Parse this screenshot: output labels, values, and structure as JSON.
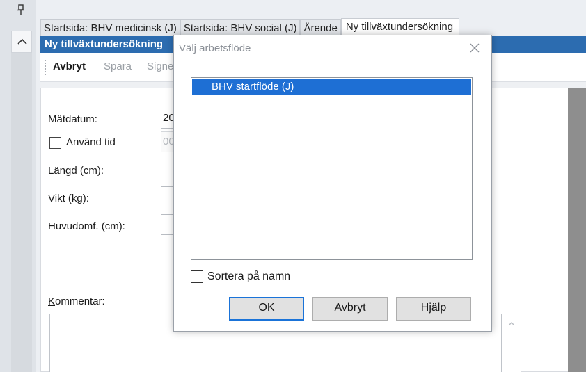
{
  "tabs": [
    {
      "label": "Startsida: BHV medicinsk (J)",
      "active": false
    },
    {
      "label": "Startsida: BHV social (J)",
      "active": false
    },
    {
      "label": "Ärende",
      "active": false
    },
    {
      "label": "Ny tillväxtundersökning",
      "active": true
    }
  ],
  "window": {
    "title": "Ny tillväxtundersökning"
  },
  "toolbar": {
    "cancel_label": "Avbryt",
    "save_label": "Spara",
    "sign_label": "Signera"
  },
  "form": {
    "measure_date_label": "Mätdatum:",
    "measure_date_value": "20",
    "use_time_label": "Använd tid",
    "use_time_checked": false,
    "time_value": "00",
    "length_label": "Längd (cm):",
    "length_value": "",
    "weight_label": "Vikt (kg):",
    "weight_value": "",
    "head_label": "Huvudomf. (cm):",
    "head_value": "",
    "comment_label_first": "K",
    "comment_label_rest": "ommentar:",
    "comment_value": ""
  },
  "dialog": {
    "title": "Välj arbetsflöde",
    "items": [
      {
        "label": "BHV startflöde (J)",
        "selected": true
      }
    ],
    "sort_label": "Sortera på namn",
    "sort_checked": false,
    "ok_label": "OK",
    "cancel_label": "Avbryt",
    "help_label": "Hjälp"
  },
  "colors": {
    "title_bar": "#2c6cb0",
    "selection": "#1e6fd4",
    "default_button_border": "#1a73d8"
  },
  "icons": {
    "pin": "pin-icon",
    "collapse": "chevron-up-icon",
    "close": "close-icon",
    "scroll_up": "chevron-up-icon"
  }
}
